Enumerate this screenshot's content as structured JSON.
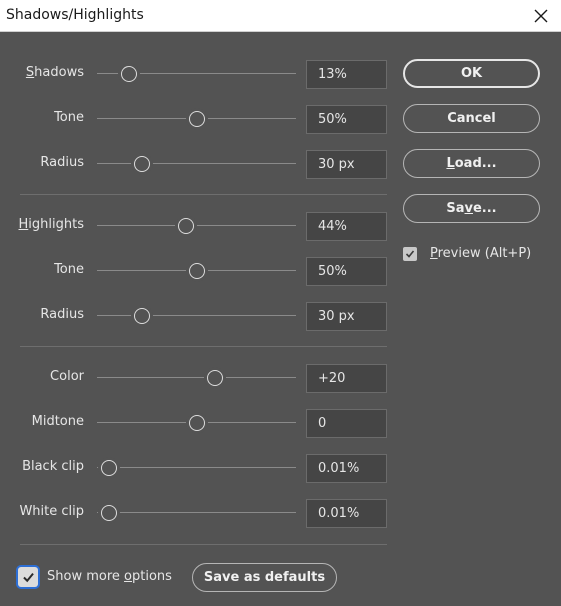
{
  "window": {
    "title": "Shadows/Highlights"
  },
  "sliders": [
    {
      "label": "Shadows",
      "access": 0,
      "value": "13%",
      "pos": 13
    },
    {
      "label": "Tone",
      "access": -1,
      "value": "50%",
      "pos": 50
    },
    {
      "label": "Radius",
      "access": -1,
      "value": "30 px",
      "pos": 20
    },
    {
      "label": "Highlights",
      "access": 0,
      "value": "44%",
      "pos": 44
    },
    {
      "label": "Tone",
      "access": -1,
      "value": "50%",
      "pos": 50
    },
    {
      "label": "Radius",
      "access": -1,
      "value": "30 px",
      "pos": 20
    },
    {
      "label": "Color",
      "access": -1,
      "value": "+20",
      "pos": 60
    },
    {
      "label": "Midtone",
      "access": -1,
      "value": "0",
      "pos": 50
    },
    {
      "label": "Black clip",
      "access": -1,
      "value": "0.01%",
      "pos": 2
    },
    {
      "label": "White clip",
      "access": -1,
      "value": "0.01%",
      "pos": 2
    }
  ],
  "buttons": {
    "ok": {
      "label": "OK",
      "access": -1
    },
    "cancel": {
      "label": "Cancel",
      "access": -1
    },
    "load": {
      "label": "Load...",
      "access": 0
    },
    "save": {
      "label": "Save...",
      "access": 2
    },
    "save_defaults": {
      "label": "Save as defaults",
      "access": -1
    }
  },
  "preview": {
    "label": "Preview (Alt+P)",
    "access": 0,
    "checked": true
  },
  "more_options": {
    "label": "Show more options",
    "access": 10,
    "checked": true
  },
  "icons": {
    "close": "close-icon",
    "check": "checkmark-icon"
  }
}
